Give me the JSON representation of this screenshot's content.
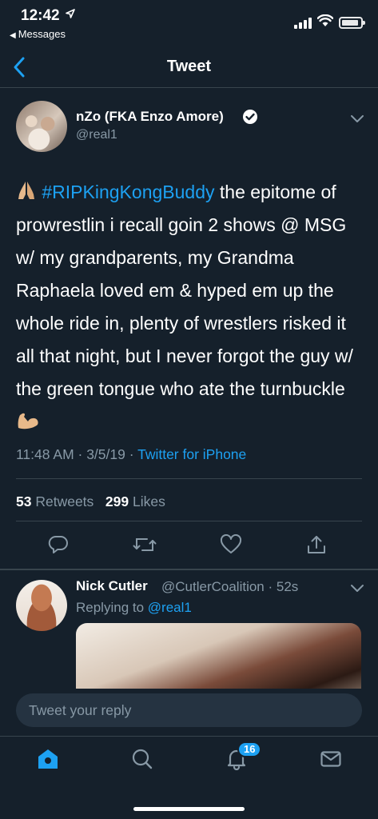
{
  "status_bar": {
    "time": "12:42",
    "back_app": "Messages"
  },
  "nav": {
    "title": "Tweet"
  },
  "tweet": {
    "author_name": "nZo (FKA Enzo Amore)",
    "handle": "@real1",
    "text_hashtag": "#RIPKingKongBuddy",
    "text_body": " the epitome of prowrestlin i recall goin 2 shows @ MSG w/ my grandparents, my Grandma Raphaela loved em & hyped em up the whole ride in, plenty of wrestlers risked it all that night, but I never forgot the guy w/ the green tongue who ate the turnbuckle ",
    "time": "11:48 AM · 3/5/19 · ",
    "source": "Twitter for iPhone",
    "retweets_count": "53",
    "retweets_label": "Retweets",
    "likes_count": "299",
    "likes_label": "Likes"
  },
  "reply": {
    "author_name": "Nick Cutler",
    "handle_time": "@CutlerCoalition · 52s",
    "replying_prefix": "Replying to ",
    "replying_handle": "@real1"
  },
  "composer": {
    "placeholder": "Tweet your reply"
  },
  "tabbar": {
    "notifications_badge": "16"
  },
  "colors": {
    "background": "#15202b",
    "accent": "#1da1f2",
    "secondary_text": "#8899a6",
    "divider": "#38444d"
  },
  "icons": {
    "back": "chevron-left-icon",
    "verified": "verified-badge-icon",
    "caret": "chevron-down-icon",
    "reply": "reply-icon",
    "retweet": "retweet-icon",
    "like": "heart-icon",
    "share": "share-icon",
    "home": "home-icon",
    "search": "search-icon",
    "notifications": "bell-icon",
    "messages": "mail-icon"
  }
}
